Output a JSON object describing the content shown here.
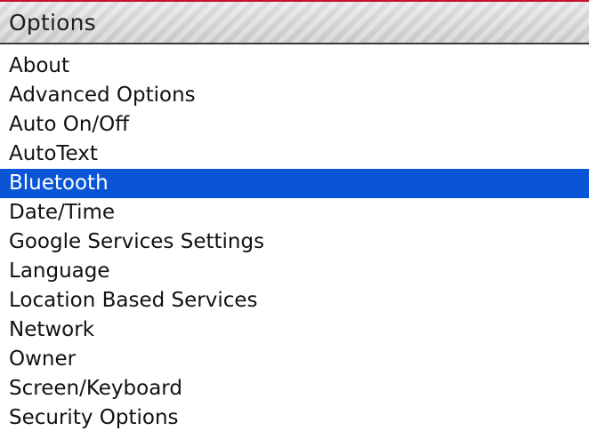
{
  "header": {
    "title": "Options",
    "accent_color": "#c8102e"
  },
  "options": {
    "selected_index": 4,
    "selection_color": "#0a55d6",
    "items": [
      {
        "label": "About"
      },
      {
        "label": "Advanced Options"
      },
      {
        "label": "Auto On/Off"
      },
      {
        "label": "AutoText"
      },
      {
        "label": "Bluetooth"
      },
      {
        "label": "Date/Time"
      },
      {
        "label": "Google Services Settings"
      },
      {
        "label": "Language"
      },
      {
        "label": "Location Based Services"
      },
      {
        "label": "Network"
      },
      {
        "label": "Owner"
      },
      {
        "label": "Screen/Keyboard"
      },
      {
        "label": "Security Options"
      }
    ]
  }
}
